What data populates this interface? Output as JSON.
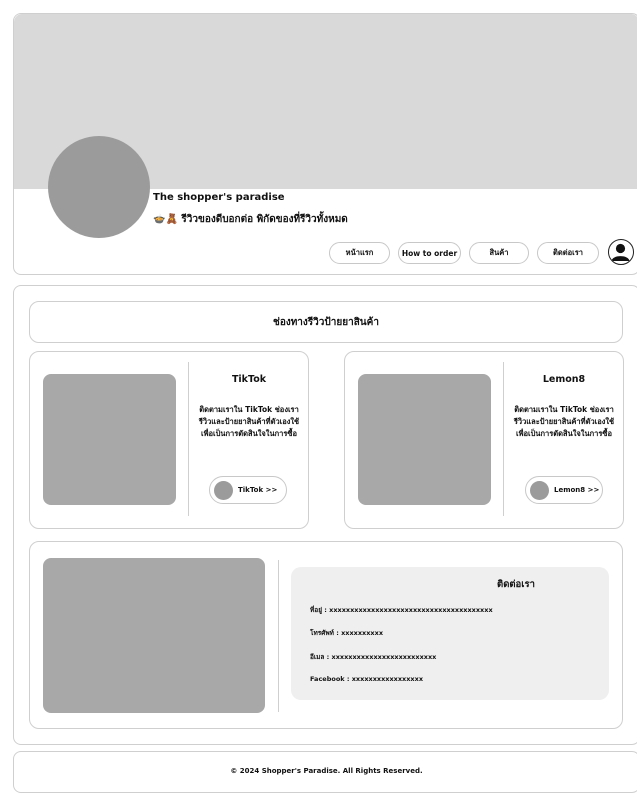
{
  "header": {
    "shop_name": "The shopper's paradise",
    "tagline": "🍲🧸 รีวิวของดีบอกต่อ พิกัดของที่รีวิวทั้งหมด",
    "nav": {
      "home": "หน้าแรก",
      "howto": "How to order",
      "products": "สินค้า",
      "contact": "ติดต่อเรา"
    },
    "profile_icon": "user-icon"
  },
  "main": {
    "section_title": "ช่องทางรีวิวป้ายยาสินค้า",
    "channels": [
      {
        "title": "TikTok",
        "description": "ติดตามเราใน TikTok ช่องเรารีวิวและป้ายยาสินค้าที่ตัวเองใช้ เพื่อเป็นการตัดสินใจในการซื้อ",
        "button": "TikTok >>"
      },
      {
        "title": "Lemon8",
        "description": "ติดตามเราใน TikTok ช่องเรารีวิวและป้ายยาสินค้าที่ตัวเองใช้ เพื่อเป็นการตัดสินใจในการซื้อ",
        "button": "Lemon8 >>"
      }
    ],
    "contact": {
      "title": "ติดต่อเรา",
      "address": "ที่อยู่ : xxxxxxxxxxxxxxxxxxxxxxxxxxxxxxxxxxxxxxx",
      "phone": "โทรศัพท์ : xxxxxxxxxx",
      "email": "อีเมล : xxxxxxxxxxxxxxxxxxxxxxxxx",
      "facebook": "Facebook : xxxxxxxxxxxxxxxxx"
    }
  },
  "footer": {
    "text": "© 2024 Shopper's Paradise. All Rights Reserved."
  },
  "colors": {
    "placeholder_gray": "#d9d9d9",
    "image_gray": "#a8a8a8",
    "avatar_gray": "#9b9b9b",
    "contact_box_bg": "#efefef",
    "border": "#cfcfcf"
  }
}
